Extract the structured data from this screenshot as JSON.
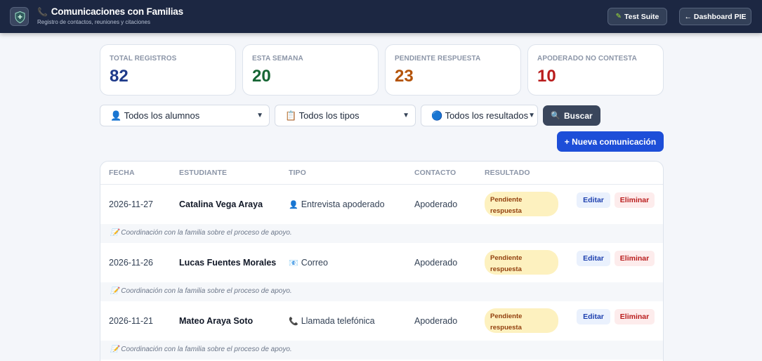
{
  "header": {
    "phone_icon": "📞",
    "title": "Comunicaciones con Familias",
    "subtitle": "Registro de contactos, reuniones y citaciones",
    "test_suite_icon": "✎",
    "test_suite_label": "Test Suite",
    "dashboard_label": "← Dashboard PIE"
  },
  "stats": [
    {
      "label": "TOTAL REGISTROS",
      "value": "82",
      "color": "#1e3a8a"
    },
    {
      "label": "ESTA SEMANA",
      "value": "20",
      "color": "#166534"
    },
    {
      "label": "PENDIENTE RESPUESTA",
      "value": "23",
      "color": "#b45309"
    },
    {
      "label": "APODERADO NO CONTESTA",
      "value": "10",
      "color": "#b91c1c"
    }
  ],
  "filters": {
    "students": "👤 Todos los alumnos",
    "types": "📋 Todos los tipos",
    "results": "🔵 Todos los resultados",
    "search_icon": "🔍",
    "search_label": "Buscar",
    "new_label": "+ Nueva comunicación"
  },
  "table": {
    "headers": [
      "FECHA",
      "ESTUDIANTE",
      "TIPO",
      "CONTACTO",
      "RESULTADO"
    ],
    "rows": [
      {
        "date": "2026-11-27",
        "student": "Catalina Vega Araya",
        "type_icon": "👤",
        "type": "Entrevista apoderado",
        "contact": "Apoderado",
        "result_line1": "Pendiente",
        "result_line2": "respuesta",
        "edit": "Editar",
        "delete": "Eliminar",
        "note": "📝 Coordinación con la familia sobre el proceso de apoyo."
      },
      {
        "date": "2026-11-26",
        "student": "Lucas Fuentes Morales",
        "type_icon": "📧",
        "type": "Correo",
        "contact": "Apoderado",
        "result_line1": "Pendiente",
        "result_line2": "respuesta",
        "edit": "Editar",
        "delete": "Eliminar",
        "note": "📝 Coordinación con la familia sobre el proceso de apoyo."
      },
      {
        "date": "2026-11-21",
        "student": "Mateo Araya Soto",
        "type_icon": "📞",
        "type": "Llamada telefónica",
        "contact": "Apoderado",
        "result_line1": "Pendiente",
        "result_line2": "respuesta",
        "edit": "Editar",
        "delete": "Eliminar",
        "note": "📝 Coordinación con la familia sobre el proceso de apoyo."
      }
    ]
  }
}
